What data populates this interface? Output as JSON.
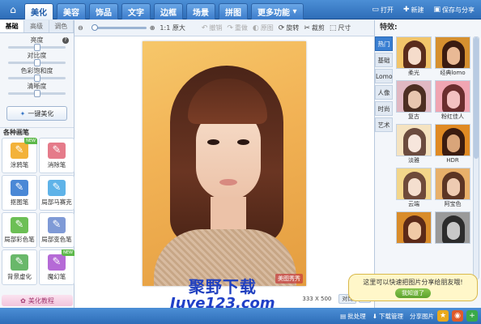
{
  "top_tabs": [
    "美化",
    "美容",
    "饰品",
    "文字",
    "边框",
    "场景",
    "拼图",
    "更多功能"
  ],
  "top_right": {
    "open": "打开",
    "new": "新建",
    "save_share": "保存与分享"
  },
  "toolbar": {
    "zoom_label": "1:1 原大",
    "undo": "撤销",
    "redo": "重做",
    "compare": "原图",
    "rotate": "旋转",
    "crop": "裁剪",
    "size": "尺寸"
  },
  "left_tabs": [
    "基础",
    "高级",
    "调色"
  ],
  "adjust_sliders": [
    {
      "label": "亮度",
      "value": 0.5
    },
    {
      "label": "对比度",
      "value": 0.5
    },
    {
      "label": "色彩饱和度",
      "value": 0.5
    },
    {
      "label": "清晰度",
      "value": 0.5
    }
  ],
  "one_key_label": "一键美化",
  "brush_section_title": "各种画笔",
  "brushes": [
    {
      "label": "涂鸦笔",
      "icon": "brush-icon",
      "color": "#f3b23a",
      "new": "NEW"
    },
    {
      "label": "消除笔",
      "icon": "eraser-icon",
      "color": "#e57b8a",
      "new": ""
    },
    {
      "label": "抠图笔",
      "icon": "cutout-icon",
      "color": "#4a88d6",
      "new": ""
    },
    {
      "label": "局部马赛克",
      "icon": "mosaic-icon",
      "color": "#5fb3e8",
      "new": ""
    },
    {
      "label": "局部彩色笔",
      "icon": "color-brush-icon",
      "color": "#6cbf55",
      "new": ""
    },
    {
      "label": "局部变色笔",
      "icon": "recolor-brush-icon",
      "color": "#7f9ad6",
      "new": ""
    },
    {
      "label": "背景虚化",
      "icon": "blur-icon",
      "color": "#69b86a",
      "new": ""
    },
    {
      "label": "魔幻笔",
      "icon": "magic-brush-icon",
      "color": "#b56ad6",
      "new": "NEW"
    }
  ],
  "tutorial_label": "美化教程",
  "canvas": {
    "width": "333",
    "height": "500",
    "watermark": "美图秀秀"
  },
  "size_bar": {
    "dims_sep": "X",
    "compare": "对比",
    "btn1": "□",
    "btn2": "□"
  },
  "brand": {
    "cn": "聚野下载",
    "en": "Juye123.com"
  },
  "right_title": "特效:",
  "effect_categories": [
    "热门",
    "基础",
    "Lomo",
    "人像",
    "时尚",
    "艺术"
  ],
  "effects": [
    {
      "label": "柔光",
      "hair": "#5a2c1c",
      "face": "#f5dccb",
      "bg": "#f2c56a"
    },
    {
      "label": "经典lomo",
      "hair": "#3a1b10",
      "face": "#e9b995",
      "bg": "#d6902f"
    },
    {
      "label": "复古",
      "hair": "#4c2e22",
      "face": "#e8c6b0",
      "bg": "#e0b8c2"
    },
    {
      "label": "粉红佳人",
      "hair": "#6a2d2d",
      "face": "#f3c1c1",
      "bg": "#f0a5b2"
    },
    {
      "label": "淡雅",
      "hair": "#6b4b3e",
      "face": "#f7e6dc",
      "bg": "#f5e3c0"
    },
    {
      "label": "HDR",
      "hair": "#3b1c10",
      "face": "#d9a57a",
      "bg": "#e08a23"
    },
    {
      "label": "云端",
      "hair": "#6e4a3a",
      "face": "#f4dfcf",
      "bg": "#f3d68a"
    },
    {
      "label": "阿宝色",
      "hair": "#5c3524",
      "face": "#eecbb2",
      "bg": "#e8b06a"
    },
    {
      "label": "",
      "hair": "#5c2a18",
      "face": "#f0caa6",
      "bg": "#d98c2a"
    },
    {
      "label": "",
      "hair": "#2c2c2c",
      "face": "#c8c8c8",
      "bg": "#9a9a9a"
    }
  ],
  "tooltip": {
    "text": "这里可以快速把图片分享给朋友哦!",
    "button": "我知道了"
  },
  "status": {
    "batch": "批处理",
    "download": "下载管理",
    "share": "分享图片"
  }
}
